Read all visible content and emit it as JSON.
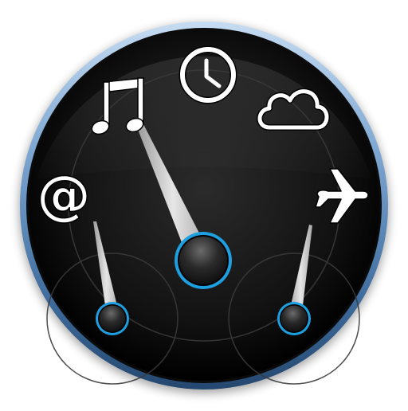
{
  "colors": {
    "bezel_light": "#b3d1ee",
    "bezel_mid": "#5d8bbd",
    "bezel_dark": "#2e5683",
    "dial_center": "#262626",
    "dial_edge": "#000000",
    "hub_ring": "#1e9fe0",
    "needle": "#c8c8c8",
    "icon_white": "#ffffff"
  },
  "icons": [
    "music-note-icon",
    "clock-icon",
    "cloud-icon",
    "at-sign-icon",
    "airplane-icon"
  ],
  "gauges": {
    "main": {
      "indicator": "music-note-icon"
    },
    "left": {
      "indicator": "at-sign-icon"
    },
    "right": {
      "indicator": "airplane-icon"
    }
  }
}
